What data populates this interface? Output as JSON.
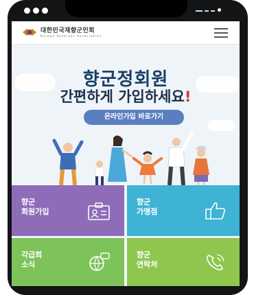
{
  "header": {
    "logo_text": "대한민국재향군인회",
    "logo_subtext": "Korean Veterans Association"
  },
  "hero": {
    "title_line1": "향군정회원",
    "title_line2_main": "간편하게 가입하세요",
    "title_line2_mark": "!",
    "cta_label": "온라인가입 바로가기"
  },
  "tiles": [
    {
      "line1": "향군",
      "line2": "회원가입",
      "color": "#8e6cb8",
      "icon": "id-card-icon"
    },
    {
      "line1": "향군",
      "line2": "가맹점",
      "color": "#3fb3d4",
      "icon": "thumbs-up-icon"
    },
    {
      "line1": "각급회",
      "line2": "소식",
      "color": "#7dc35a",
      "icon": "globe-chat-icon"
    },
    {
      "line1": "향군",
      "line2": "연락처",
      "color": "#8fc64e",
      "icon": "phone-icon"
    }
  ]
}
